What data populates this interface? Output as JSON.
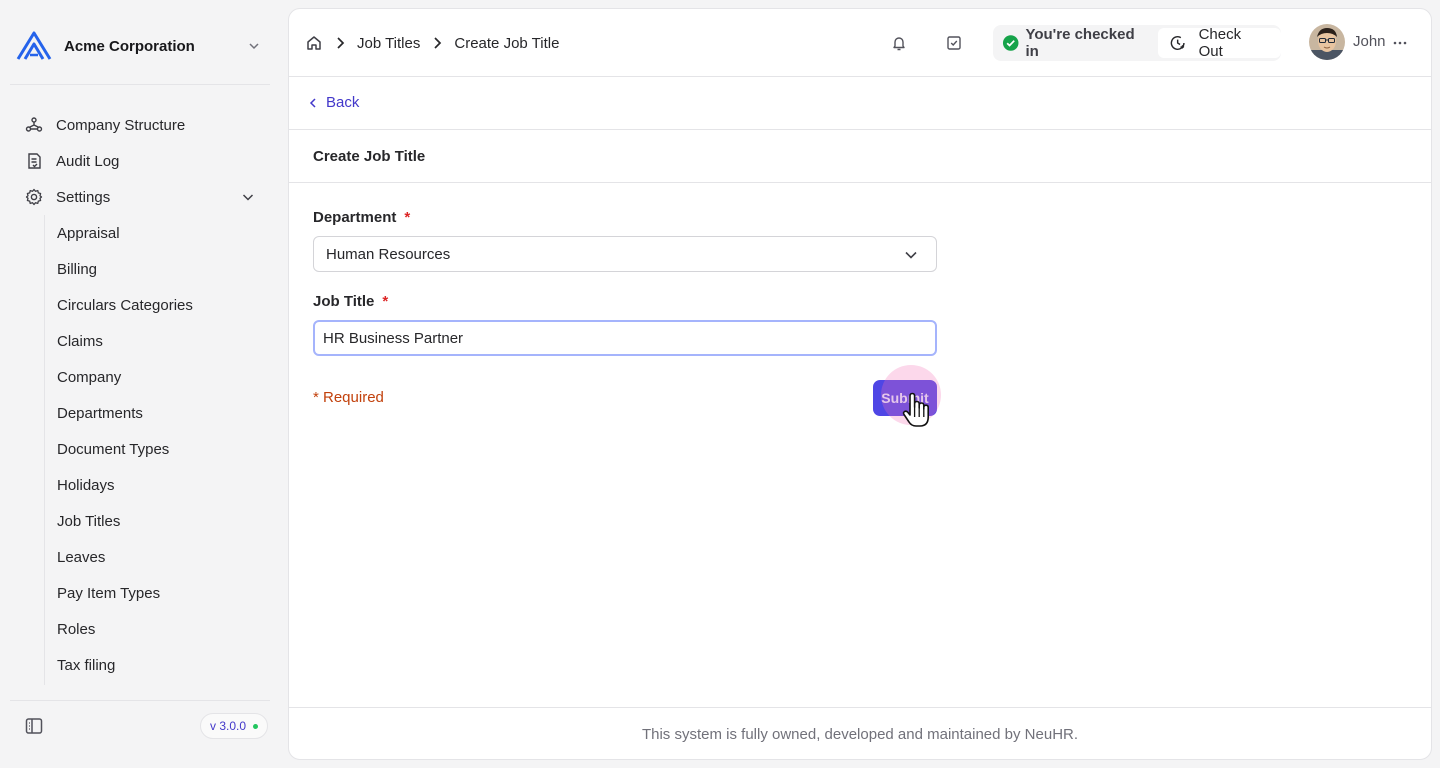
{
  "company": {
    "name": "Acme Corporation",
    "logo_icon": "acme-logo-icon"
  },
  "sidebar": {
    "items": [
      {
        "label": "Company Structure",
        "icon": "network-icon"
      },
      {
        "label": "Audit Log",
        "icon": "receipt-icon"
      },
      {
        "label": "Settings",
        "icon": "gear-icon",
        "expanded": true
      }
    ],
    "settings_items": [
      "Appraisal",
      "Billing",
      "Circulars Categories",
      "Claims",
      "Company",
      "Departments",
      "Document Types",
      "Holidays",
      "Job Titles",
      "Leaves",
      "Pay Item Types",
      "Roles",
      "Tax filing"
    ],
    "version": "v 3.0.0"
  },
  "header": {
    "breadcrumb": [
      "Job Titles",
      "Create Job Title"
    ],
    "checkin_status": "You're checked in",
    "checkout_label": "Check Out",
    "user_name": "John"
  },
  "page": {
    "back_label": "Back",
    "title": "Create Job Title",
    "form": {
      "department_label": "Department",
      "department_value": "Human Resources",
      "job_title_label": "Job Title",
      "job_title_value": "HR Business Partner",
      "required_star": "*",
      "required_note": "* Required",
      "submit_label": "Submit"
    }
  },
  "footer": {
    "text": "This system is fully owned, developed and maintained by NeuHR."
  },
  "colors": {
    "accent": "#4f46e5",
    "link": "#4338ca",
    "success": "#16a34a",
    "required": "#dc2626"
  }
}
